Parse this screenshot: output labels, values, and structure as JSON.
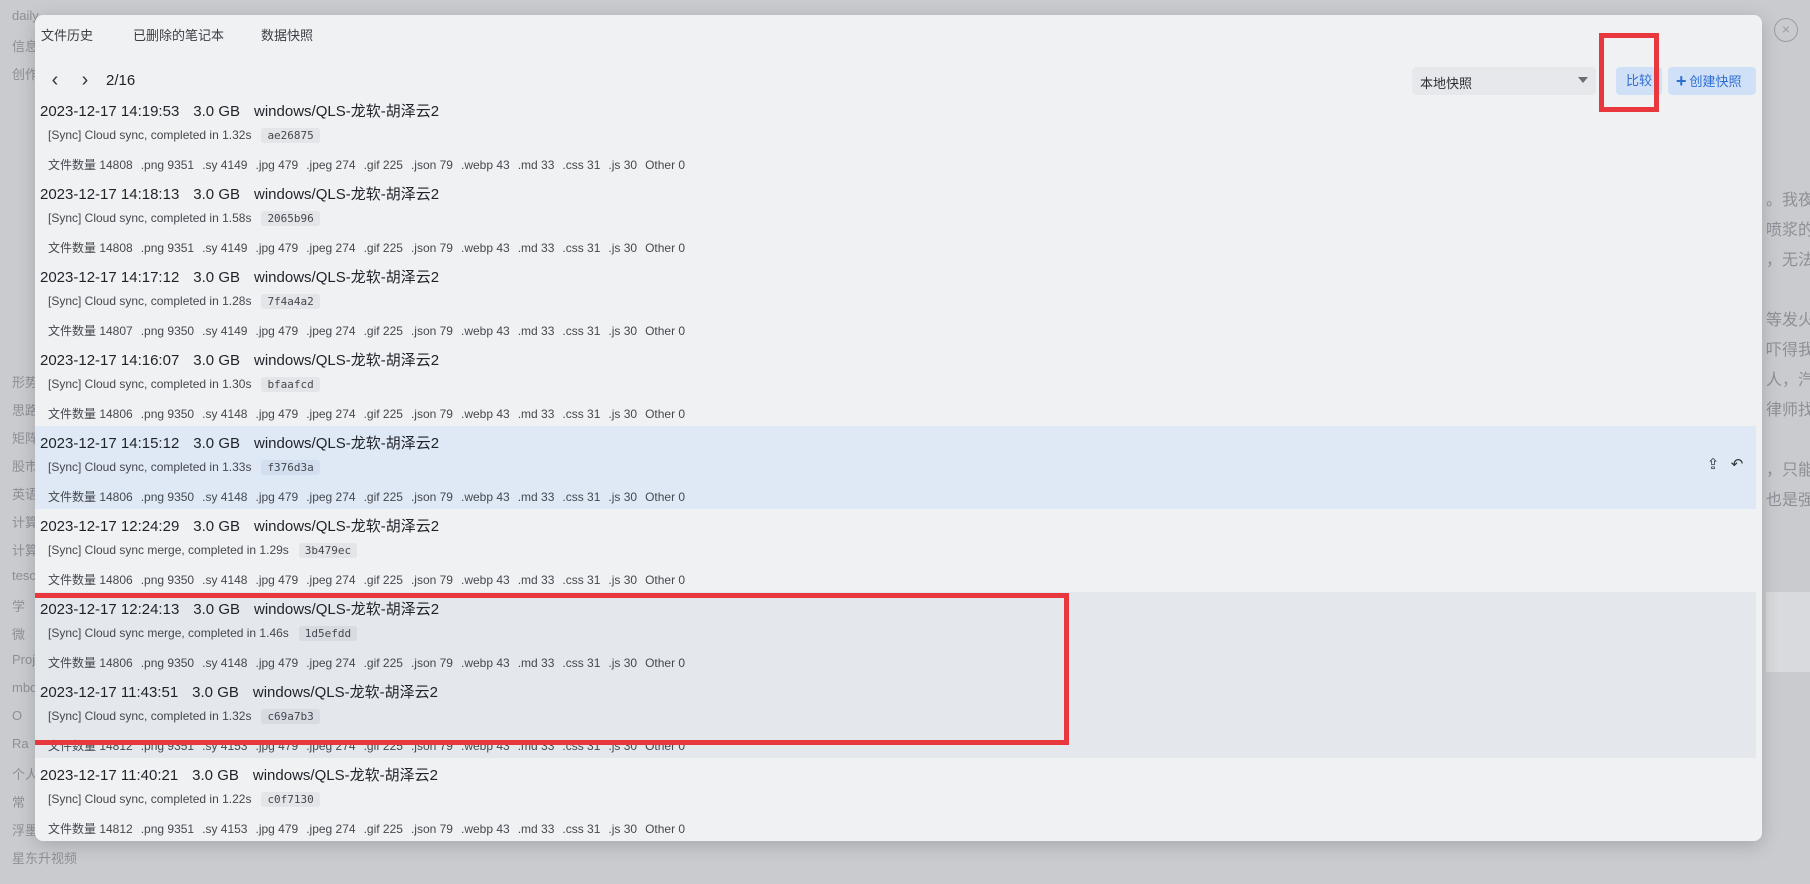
{
  "background": {
    "left_lines": [
      "daily",
      "信息",
      "创作",
      "",
      "",
      "",
      "",
      "",
      "",
      "",
      "",
      "",
      "",
      "形势",
      "思路",
      "矩阵",
      "股市",
      "英语",
      "计算",
      "计算",
      "tesc",
      "学",
      "微",
      "Proje",
      "mbos",
      "O",
      "Ra",
      "个人",
      "常",
      "浮墨笔记",
      "星东升视频"
    ],
    "right_lines": [
      "。我夜",
      "喷浆的",
      "，无法",
      "",
      "等发火",
      "吓得我",
      "人，汽",
      "律师找",
      "",
      "，只能",
      "也是强"
    ],
    "close_symbol": "×"
  },
  "dialog": {
    "tabs": [
      {
        "label": "文件历史"
      },
      {
        "label": "已删除的笔记本"
      },
      {
        "label": "数据快照"
      }
    ],
    "toolbar": {
      "prev_symbol": "‹",
      "next_symbol": "›",
      "page_indicator": "2/16",
      "snapshot_select": "本地快照",
      "compare_label": "比较",
      "create_label": "创建快照",
      "create_icon": "plus-icon"
    },
    "rows": [
      {
        "datetime": "2023-12-17 14:19:53",
        "size": "3.0 GB",
        "device": "windows/QLS-龙软-胡泽云2",
        "memo": "[Sync] Cloud sync, completed in 1.32s",
        "hash": "ae26875",
        "stats": [
          "文件数量 14808",
          ".png 9351",
          ".sy 4149",
          ".jpg 479",
          ".jpeg 274",
          ".gif 225",
          ".json 79",
          ".webp 43",
          ".md 33",
          ".css 31",
          ".js 30",
          "Other 0"
        ]
      },
      {
        "datetime": "2023-12-17 14:18:13",
        "size": "3.0 GB",
        "device": "windows/QLS-龙软-胡泽云2",
        "memo": "[Sync] Cloud sync, completed in 1.58s",
        "hash": "2065b96",
        "stats": [
          "文件数量 14808",
          ".png 9351",
          ".sy 4149",
          ".jpg 479",
          ".jpeg 274",
          ".gif 225",
          ".json 79",
          ".webp 43",
          ".md 33",
          ".css 31",
          ".js 30",
          "Other 0"
        ]
      },
      {
        "datetime": "2023-12-17 14:17:12",
        "size": "3.0 GB",
        "device": "windows/QLS-龙软-胡泽云2",
        "memo": "[Sync] Cloud sync, completed in 1.28s",
        "hash": "7f4a4a2",
        "stats": [
          "文件数量 14807",
          ".png 9350",
          ".sy 4149",
          ".jpg 479",
          ".jpeg 274",
          ".gif 225",
          ".json 79",
          ".webp 43",
          ".md 33",
          ".css 31",
          ".js 30",
          "Other 0"
        ]
      },
      {
        "datetime": "2023-12-17 14:16:07",
        "size": "3.0 GB",
        "device": "windows/QLS-龙软-胡泽云2",
        "memo": "[Sync] Cloud sync, completed in 1.30s",
        "hash": "bfaafcd",
        "stats": [
          "文件数量 14806",
          ".png 9350",
          ".sy 4148",
          ".jpg 479",
          ".jpeg 274",
          ".gif 225",
          ".json 79",
          ".webp 43",
          ".md 33",
          ".css 31",
          ".js 30",
          "Other 0"
        ]
      },
      {
        "datetime": "2023-12-17 14:15:12",
        "size": "3.0 GB",
        "device": "windows/QLS-龙软-胡泽云2",
        "memo": "[Sync] Cloud sync, completed in 1.33s",
        "hash": "f376d3a",
        "stats": [
          "文件数量 14806",
          ".png 9350",
          ".sy 4148",
          ".jpg 479",
          ".jpeg 274",
          ".gif 225",
          ".json 79",
          ".webp 43",
          ".md 33",
          ".css 31",
          ".js 30",
          "Other 0"
        ],
        "state": "selected",
        "actions": [
          "upload-icon",
          "undo-icon"
        ]
      },
      {
        "datetime": "2023-12-17 12:24:29",
        "size": "3.0 GB",
        "device": "windows/QLS-龙软-胡泽云2",
        "memo": "[Sync] Cloud sync merge, completed in 1.29s",
        "hash": "3b479ec",
        "stats": [
          "文件数量 14806",
          ".png 9350",
          ".sy 4148",
          ".jpg 479",
          ".jpeg 274",
          ".gif 225",
          ".json 79",
          ".webp 43",
          ".md 33",
          ".css 31",
          ".js 30",
          "Other 0"
        ]
      },
      {
        "datetime": "2023-12-17 12:24:13",
        "size": "3.0 GB",
        "device": "windows/QLS-龙软-胡泽云2",
        "memo": "[Sync] Cloud sync merge, completed in 1.46s",
        "hash": "1d5efdd",
        "stats": [
          "文件数量 14806",
          ".png 9350",
          ".sy 4148",
          ".jpg 479",
          ".jpeg 274",
          ".gif 225",
          ".json 79",
          ".webp 43",
          ".md 33",
          ".css 31",
          ".js 30",
          "Other 0"
        ],
        "state": "dim"
      },
      {
        "datetime": "2023-12-17 11:43:51",
        "size": "3.0 GB",
        "device": "windows/QLS-龙软-胡泽云2",
        "memo": "[Sync] Cloud sync, completed in 1.32s",
        "hash": "c69a7b3",
        "stats": [
          "文件数量 14812",
          ".png 9351",
          ".sy 4153",
          ".jpg 479",
          ".jpeg 274",
          ".gif 225",
          ".json 79",
          ".webp 43",
          ".md 33",
          ".css 31",
          ".js 30",
          "Other 0"
        ],
        "state": "dim"
      },
      {
        "datetime": "2023-12-17 11:40:21",
        "size": "3.0 GB",
        "device": "windows/QLS-龙软-胡泽云2",
        "memo": "[Sync] Cloud sync, completed in 1.22s",
        "hash": "c0f7130",
        "stats": [
          "文件数量 14812",
          ".png 9351",
          ".sy 4153",
          ".jpg 479",
          ".jpeg 274",
          ".gif 225",
          ".json 79",
          ".webp 43",
          ".md 33",
          ".css 31",
          ".js 30",
          "Other 0"
        ]
      }
    ]
  },
  "colors": {
    "accent": "#2f6fd0",
    "annotation": "#e8383d",
    "selected_row": "#dfe9f6"
  }
}
